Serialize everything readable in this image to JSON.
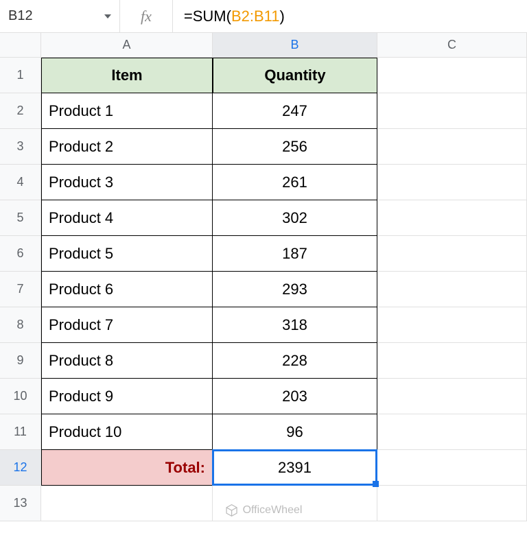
{
  "name_box": "B12",
  "formula": {
    "eq": "=",
    "func": "SUM",
    "open": "(",
    "range": "B2:B11",
    "close": ")"
  },
  "columns": [
    "A",
    "B",
    "C"
  ],
  "rows": [
    "1",
    "2",
    "3",
    "4",
    "5",
    "6",
    "7",
    "8",
    "9",
    "10",
    "11",
    "12",
    "13"
  ],
  "headers": {
    "item": "Item",
    "quantity": "Quantity"
  },
  "data": [
    {
      "item": "Product 1",
      "quantity": "247"
    },
    {
      "item": "Product 2",
      "quantity": "256"
    },
    {
      "item": "Product 3",
      "quantity": "261"
    },
    {
      "item": "Product 4",
      "quantity": "302"
    },
    {
      "item": "Product 5",
      "quantity": "187"
    },
    {
      "item": "Product 6",
      "quantity": "293"
    },
    {
      "item": "Product 7",
      "quantity": "318"
    },
    {
      "item": "Product 8",
      "quantity": "228"
    },
    {
      "item": "Product 9",
      "quantity": "203"
    },
    {
      "item": "Product 10",
      "quantity": "96"
    }
  ],
  "total": {
    "label": "Total:",
    "value": "2391"
  },
  "selected": {
    "row": "12",
    "col": "B"
  },
  "watermark": "OfficeWheel"
}
